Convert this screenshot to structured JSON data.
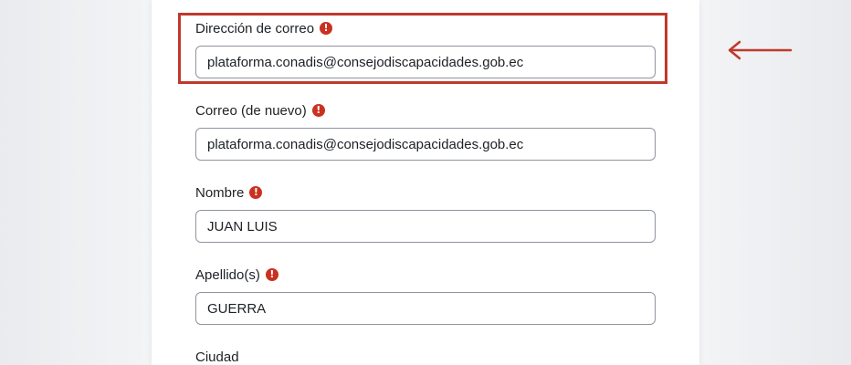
{
  "form": {
    "fields": [
      {
        "label": "Dirección de correo",
        "required_mark": "!",
        "value": "plataforma.conadis@consejodiscapacidades.gob.ec"
      },
      {
        "label": "Correo (de nuevo)",
        "required_mark": "!",
        "value": "plataforma.conadis@consejodiscapacidades.gob.ec"
      },
      {
        "label": "Nombre",
        "required_mark": "!",
        "value": "JUAN LUIS"
      },
      {
        "label": "Apellido(s)",
        "required_mark": "!",
        "value": "GUERRA"
      },
      {
        "label": "Ciudad"
      }
    ]
  },
  "colors": {
    "required_icon": "#ca3120",
    "highlight": "#c0392b",
    "input_border": "#8f959e",
    "text": "#1d2125"
  },
  "icons": {
    "required": "exclamation-circle-icon",
    "annotation_arrow": "arrow-left-icon"
  }
}
